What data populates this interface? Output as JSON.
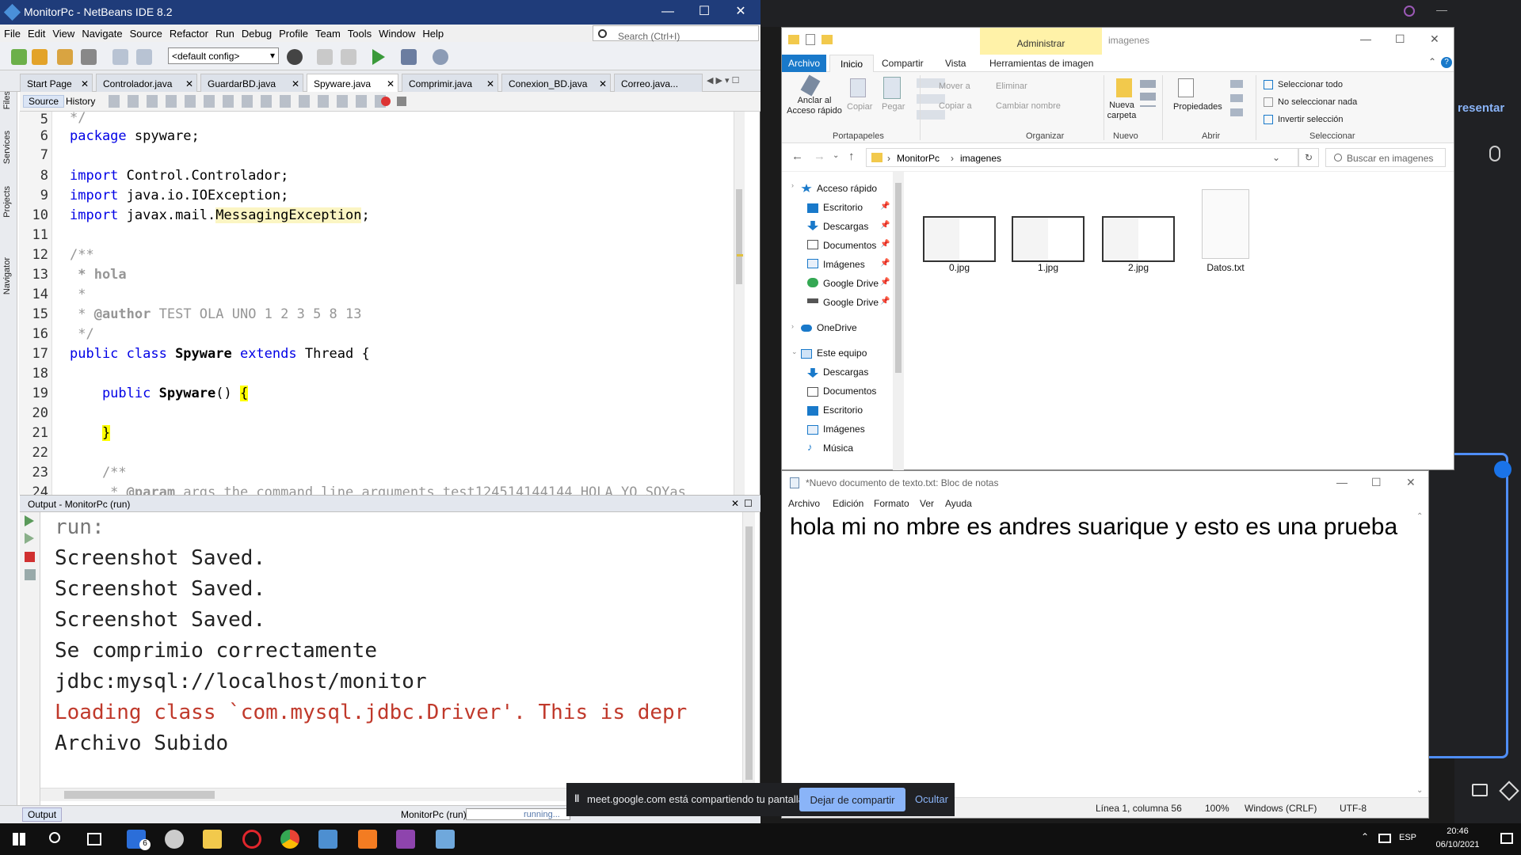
{
  "netbeans": {
    "title": "MonitorPc - NetBeans IDE 8.2",
    "menu": [
      "File",
      "Edit",
      "View",
      "Navigate",
      "Source",
      "Refactor",
      "Run",
      "Debug",
      "Profile",
      "Team",
      "Tools",
      "Window",
      "Help"
    ],
    "search_placeholder": "Search (Ctrl+I)",
    "config": "<default config>",
    "tabs": [
      "Start Page",
      "Controlador.java",
      "GuardarBD.java",
      "Spyware.java",
      "Comprimir.java",
      "Conexion_BD.java",
      "Correo.java..."
    ],
    "active_tab": "Spyware.java",
    "editor_modes": {
      "source": "Source",
      "history": "History"
    },
    "side_panels": [
      "Files",
      "Services",
      "Projects",
      "Navigator"
    ],
    "line_numbers": [
      "5",
      "6",
      "7",
      "8",
      "9",
      "10",
      "11",
      "12",
      "13",
      "14",
      "15",
      "16",
      "17",
      "18",
      "19",
      "20",
      "21",
      "22",
      "23",
      "24"
    ],
    "code": {
      "l5": "*/",
      "l6_kw": "package",
      "l6_rest": " spyware;",
      "l8_kw": "import",
      "l8_rest": " Control.Controlador;",
      "l9_kw": "import",
      "l9_rest": " java.io.IOException;",
      "l10_kw": "import",
      "l10_rest": " javax.mail.",
      "l10_hl": "MessagingException",
      "l10_end": ";",
      "l12": "/**",
      "l13": " * hola",
      "l14": " *",
      "l15_a": " * ",
      "l15_tag": "@author",
      "l15_rest": " TEST OLA UNO 1 2 3 5 8 13",
      "l16": " */",
      "l17_kw1": "public class ",
      "l17_name": "Spyware",
      "l17_kw2": " extends",
      "l17_rest": " Thread {",
      "l19_kw": "    public ",
      "l19_name": "Spyware",
      "l19_rest": "() ",
      "l19_brace": "{",
      "l21_brace": "}",
      "l23": "    /**",
      "l24_a": "     * ",
      "l24_tag": "@param",
      "l24_rest": " args the command line arguments test124514144144 HOLA YO SOYas"
    },
    "output": {
      "title": "Output - MonitorPc (run)",
      "lines": [
        "run:",
        "Screenshot Saved.",
        "Screenshot Saved.",
        "Screenshot Saved.",
        "Se comprimio correctamente",
        "jdbc:mysql://localhost/monitor",
        "Loading class `com.mysql.jdbc.Driver'. This is depr",
        "Archivo Subido"
      ],
      "warning_color": "#c0392b"
    },
    "status": {
      "output_tab": "Output",
      "project": "MonitorPc (run)",
      "state": "running..."
    }
  },
  "explorer": {
    "context_tab": "Administrar",
    "title": "imagenes",
    "ribbon_tabs": [
      "Archivo",
      "Inicio",
      "Compartir",
      "Vista",
      "Herramientas de imagen"
    ],
    "ribbon": {
      "anclar": "Anclar al Acceso rápido",
      "copiar": "Copiar",
      "pegar": "Pegar",
      "mover": "Mover a",
      "copiar_a": "Copiar a",
      "eliminar": "Eliminar",
      "cambiar": "Cambiar nombre",
      "nueva": "Nueva carpeta",
      "propiedades": "Propiedades",
      "sel_todo": "Seleccionar todo",
      "no_sel": "No seleccionar nada",
      "invertir": "Invertir selección",
      "groups": [
        "Portapapeles",
        "Organizar",
        "Nuevo",
        "Abrir",
        "Seleccionar"
      ]
    },
    "breadcrumb": [
      "MonitorPc",
      "imagenes"
    ],
    "search_placeholder": "Buscar en imagenes",
    "nav": [
      "Acceso rápido",
      "Escritorio",
      "Descargas",
      "Documentos",
      "Imágenes",
      "Google Drive",
      "Google Drive",
      "OneDrive",
      "Este equipo",
      "Descargas",
      "Documentos",
      "Escritorio",
      "Imágenes",
      "Música"
    ],
    "files": [
      "0.jpg",
      "1.jpg",
      "2.jpg",
      "Datos.txt"
    ]
  },
  "notepad": {
    "title": "*Nuevo documento de texto.txt: Bloc de notas",
    "menu": [
      "Archivo",
      "Edición",
      "Formato",
      "Ver",
      "Ayuda"
    ],
    "text": "hola mi no mbre es andres suarique y esto es una prueba",
    "status": {
      "position": "Línea 1, columna 56",
      "zoom": "100%",
      "eol": "Windows (CRLF)",
      "encoding": "UTF-8"
    }
  },
  "meet": {
    "message": "meet.google.com está compartiendo tu pantalla.",
    "stop": "Dejar de compartir",
    "hide": "Ocultar"
  },
  "background": {
    "partial_text": "resentar"
  },
  "taskbar": {
    "language": "ESP",
    "time": "20:46",
    "date": "06/10/2021",
    "badge": "6"
  }
}
